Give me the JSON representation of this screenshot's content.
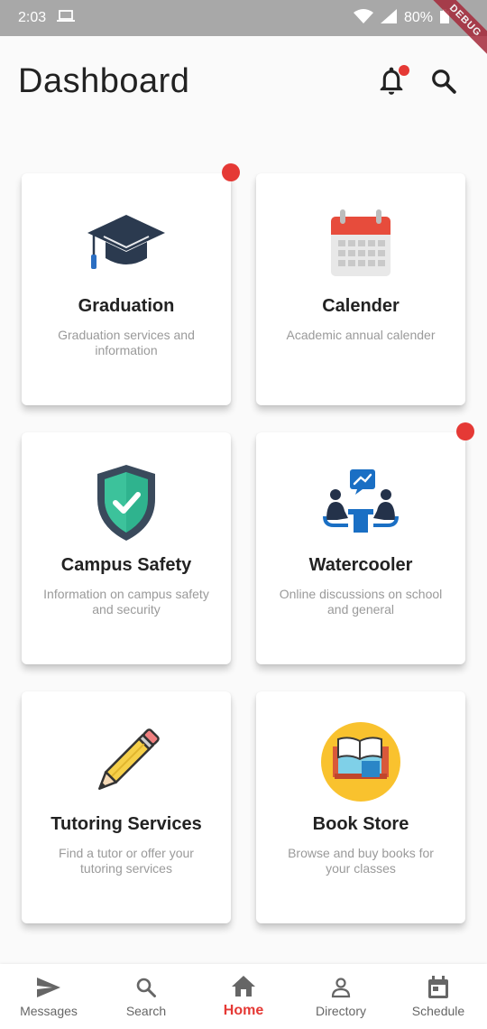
{
  "status_bar": {
    "time": "2:03",
    "battery": "80%",
    "debug_label": "DEBUG"
  },
  "header": {
    "title": "Dashboard"
  },
  "cards": [
    {
      "title": "Graduation",
      "description": "Graduation services and information",
      "icon": "graduation-cap-icon",
      "has_dot": true
    },
    {
      "title": "Calender",
      "description": "Academic annual calender",
      "icon": "calendar-icon",
      "has_dot": false
    },
    {
      "title": "Campus Safety",
      "description": "Information on campus safety and security",
      "icon": "shield-icon",
      "has_dot": false
    },
    {
      "title": "Watercooler",
      "description": "Online discussions on school and general",
      "icon": "discussion-icon",
      "has_dot": true
    },
    {
      "title": "Tutoring Services",
      "description": "Find a tutor or offer your tutoring services",
      "icon": "pencil-icon",
      "has_dot": false
    },
    {
      "title": "Book Store",
      "description": "Browse and buy books for your classes",
      "icon": "book-store-icon",
      "has_dot": false
    }
  ],
  "bottom_nav": [
    {
      "label": "Messages",
      "icon": "send-icon",
      "active": false
    },
    {
      "label": "Search",
      "icon": "search-icon",
      "active": false
    },
    {
      "label": "Home",
      "icon": "home-icon",
      "active": true
    },
    {
      "label": "Directory",
      "icon": "person-icon",
      "active": false
    },
    {
      "label": "Schedule",
      "icon": "calendar-day-icon",
      "active": false
    }
  ],
  "colors": {
    "accent": "#e53935",
    "status_bar": "#a8a8a8",
    "background": "#fafafa"
  }
}
